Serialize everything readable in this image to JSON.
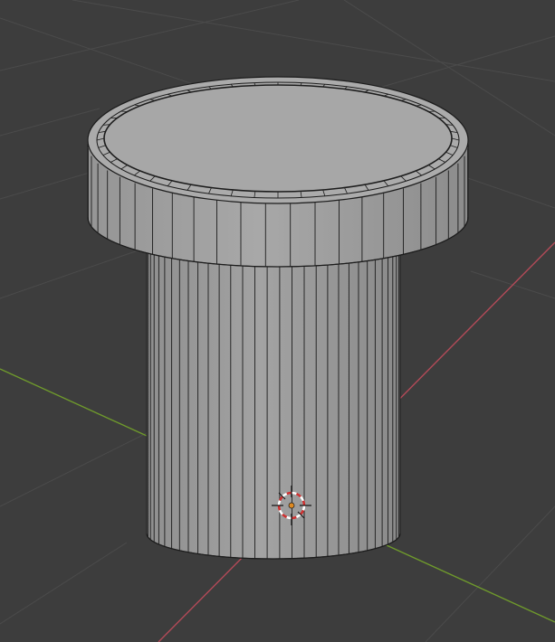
{
  "viewport": {
    "background_color": "#3d3d3d",
    "grid_line_color": "#4b4b4b",
    "x_axis_color": "#b34a58",
    "y_axis_color": "#6f9a2c"
  },
  "object": {
    "shape": "cylinder",
    "cap": "flanged-lid",
    "shading": "solid-gray",
    "wireframe_overlay": true,
    "body_color": "#9a9a9a",
    "lid_color": "#a9a9a9",
    "edge_color": "#1c1c1c"
  },
  "cursor_3d": {
    "icon": "3d-cursor-icon",
    "ring_colors": [
      "#d03030",
      "#ffffff"
    ],
    "center_color": "#e08a20"
  }
}
